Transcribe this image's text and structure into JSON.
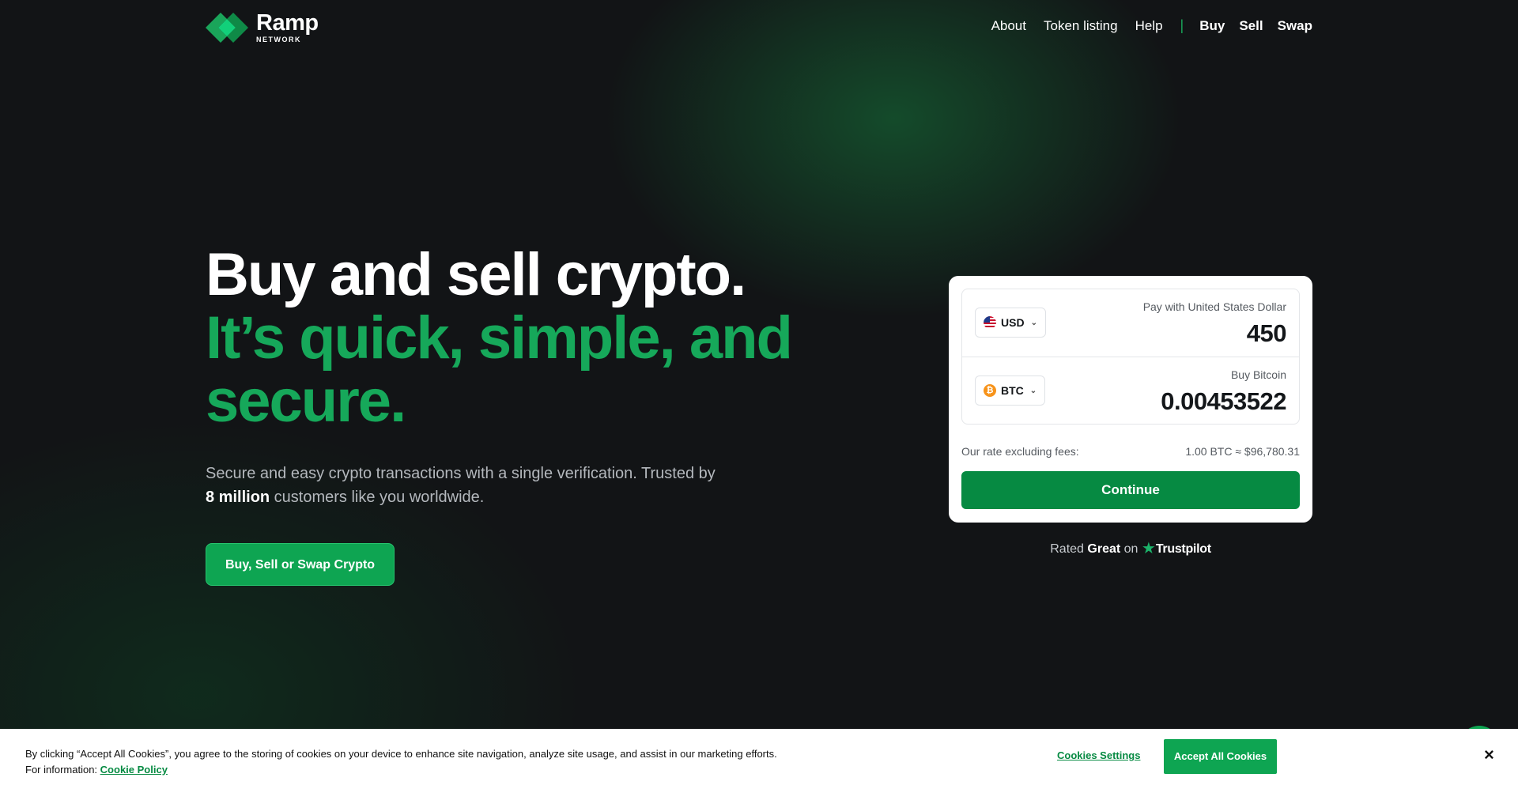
{
  "brand": {
    "name": "Ramp",
    "sub": "NETWORK",
    "accent": "#16a85a"
  },
  "nav": {
    "links": [
      "About",
      "Token listing",
      "Help"
    ],
    "divider": "|",
    "actions": [
      "Buy",
      "Sell",
      "Swap"
    ]
  },
  "hero": {
    "title_line1": "Buy and sell crypto.",
    "title_line2": "It’s quick, simple, and",
    "title_line3": "secure.",
    "subtitle_pre": "Secure and easy crypto transactions with a single verification. Trusted by",
    "subtitle_bold": "8 million",
    "subtitle_post": " customers like you worldwide.",
    "cta": "Buy, Sell or Swap Crypto"
  },
  "widget": {
    "pay_currency": "USD",
    "pay_label": "Pay with United States Dollar",
    "pay_value": "450",
    "buy_currency": "BTC",
    "buy_label": "Buy Bitcoin",
    "buy_value": "0.00453522",
    "rate_label": "Our rate excluding fees:",
    "rate_value": "1.00 BTC ≈ $96,780.31",
    "continue": "Continue"
  },
  "trust": {
    "rated": "Rated",
    "rating": "Great",
    "on": "on",
    "provider": "Trustpilot"
  },
  "cookie": {
    "text": "By clicking “Accept All Cookies”, you agree to the storing of cookies on your device to enhance site navigation, analyze site usage, and assist in our marketing efforts.",
    "info_label": "For information:",
    "policy_link": "Cookie Policy",
    "settings": "Cookies Settings",
    "accept": "Accept All Cookies",
    "close": "×"
  }
}
